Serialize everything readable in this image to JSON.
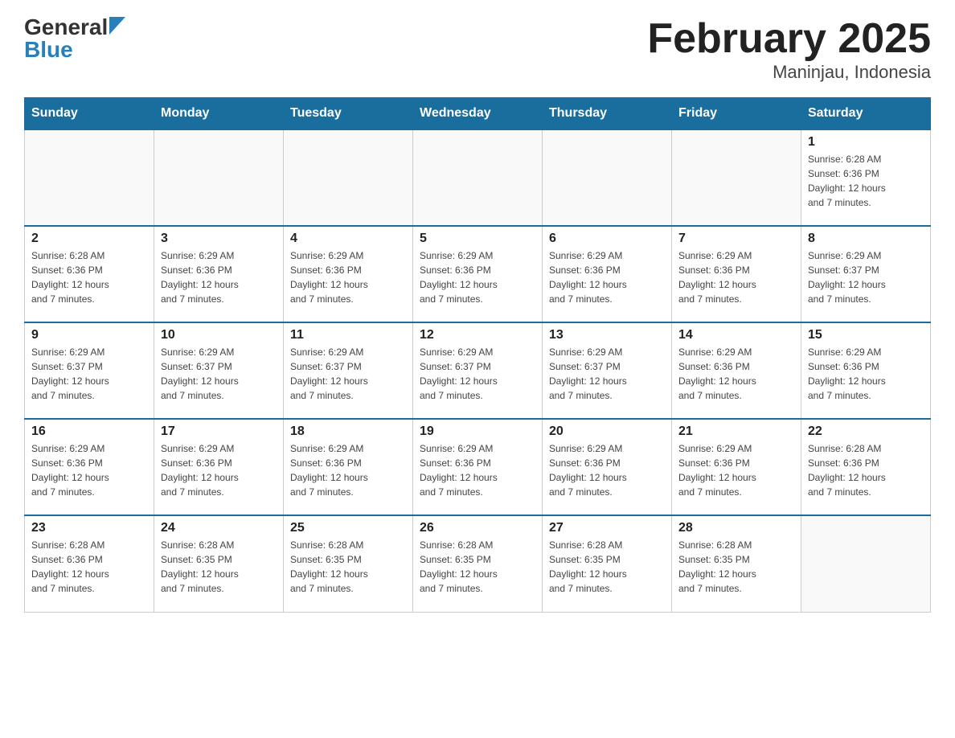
{
  "logo": {
    "general": "General",
    "blue": "Blue"
  },
  "title": "February 2025",
  "subtitle": "Maninjau, Indonesia",
  "weekdays": [
    "Sunday",
    "Monday",
    "Tuesday",
    "Wednesday",
    "Thursday",
    "Friday",
    "Saturday"
  ],
  "weeks": [
    [
      {
        "day": "",
        "info": ""
      },
      {
        "day": "",
        "info": ""
      },
      {
        "day": "",
        "info": ""
      },
      {
        "day": "",
        "info": ""
      },
      {
        "day": "",
        "info": ""
      },
      {
        "day": "",
        "info": ""
      },
      {
        "day": "1",
        "info": "Sunrise: 6:28 AM\nSunset: 6:36 PM\nDaylight: 12 hours\nand 7 minutes."
      }
    ],
    [
      {
        "day": "2",
        "info": "Sunrise: 6:28 AM\nSunset: 6:36 PM\nDaylight: 12 hours\nand 7 minutes."
      },
      {
        "day": "3",
        "info": "Sunrise: 6:29 AM\nSunset: 6:36 PM\nDaylight: 12 hours\nand 7 minutes."
      },
      {
        "day": "4",
        "info": "Sunrise: 6:29 AM\nSunset: 6:36 PM\nDaylight: 12 hours\nand 7 minutes."
      },
      {
        "day": "5",
        "info": "Sunrise: 6:29 AM\nSunset: 6:36 PM\nDaylight: 12 hours\nand 7 minutes."
      },
      {
        "day": "6",
        "info": "Sunrise: 6:29 AM\nSunset: 6:36 PM\nDaylight: 12 hours\nand 7 minutes."
      },
      {
        "day": "7",
        "info": "Sunrise: 6:29 AM\nSunset: 6:36 PM\nDaylight: 12 hours\nand 7 minutes."
      },
      {
        "day": "8",
        "info": "Sunrise: 6:29 AM\nSunset: 6:37 PM\nDaylight: 12 hours\nand 7 minutes."
      }
    ],
    [
      {
        "day": "9",
        "info": "Sunrise: 6:29 AM\nSunset: 6:37 PM\nDaylight: 12 hours\nand 7 minutes."
      },
      {
        "day": "10",
        "info": "Sunrise: 6:29 AM\nSunset: 6:37 PM\nDaylight: 12 hours\nand 7 minutes."
      },
      {
        "day": "11",
        "info": "Sunrise: 6:29 AM\nSunset: 6:37 PM\nDaylight: 12 hours\nand 7 minutes."
      },
      {
        "day": "12",
        "info": "Sunrise: 6:29 AM\nSunset: 6:37 PM\nDaylight: 12 hours\nand 7 minutes."
      },
      {
        "day": "13",
        "info": "Sunrise: 6:29 AM\nSunset: 6:37 PM\nDaylight: 12 hours\nand 7 minutes."
      },
      {
        "day": "14",
        "info": "Sunrise: 6:29 AM\nSunset: 6:36 PM\nDaylight: 12 hours\nand 7 minutes."
      },
      {
        "day": "15",
        "info": "Sunrise: 6:29 AM\nSunset: 6:36 PM\nDaylight: 12 hours\nand 7 minutes."
      }
    ],
    [
      {
        "day": "16",
        "info": "Sunrise: 6:29 AM\nSunset: 6:36 PM\nDaylight: 12 hours\nand 7 minutes."
      },
      {
        "day": "17",
        "info": "Sunrise: 6:29 AM\nSunset: 6:36 PM\nDaylight: 12 hours\nand 7 minutes."
      },
      {
        "day": "18",
        "info": "Sunrise: 6:29 AM\nSunset: 6:36 PM\nDaylight: 12 hours\nand 7 minutes."
      },
      {
        "day": "19",
        "info": "Sunrise: 6:29 AM\nSunset: 6:36 PM\nDaylight: 12 hours\nand 7 minutes."
      },
      {
        "day": "20",
        "info": "Sunrise: 6:29 AM\nSunset: 6:36 PM\nDaylight: 12 hours\nand 7 minutes."
      },
      {
        "day": "21",
        "info": "Sunrise: 6:29 AM\nSunset: 6:36 PM\nDaylight: 12 hours\nand 7 minutes."
      },
      {
        "day": "22",
        "info": "Sunrise: 6:28 AM\nSunset: 6:36 PM\nDaylight: 12 hours\nand 7 minutes."
      }
    ],
    [
      {
        "day": "23",
        "info": "Sunrise: 6:28 AM\nSunset: 6:36 PM\nDaylight: 12 hours\nand 7 minutes."
      },
      {
        "day": "24",
        "info": "Sunrise: 6:28 AM\nSunset: 6:35 PM\nDaylight: 12 hours\nand 7 minutes."
      },
      {
        "day": "25",
        "info": "Sunrise: 6:28 AM\nSunset: 6:35 PM\nDaylight: 12 hours\nand 7 minutes."
      },
      {
        "day": "26",
        "info": "Sunrise: 6:28 AM\nSunset: 6:35 PM\nDaylight: 12 hours\nand 7 minutes."
      },
      {
        "day": "27",
        "info": "Sunrise: 6:28 AM\nSunset: 6:35 PM\nDaylight: 12 hours\nand 7 minutes."
      },
      {
        "day": "28",
        "info": "Sunrise: 6:28 AM\nSunset: 6:35 PM\nDaylight: 12 hours\nand 7 minutes."
      },
      {
        "day": "",
        "info": ""
      }
    ]
  ]
}
